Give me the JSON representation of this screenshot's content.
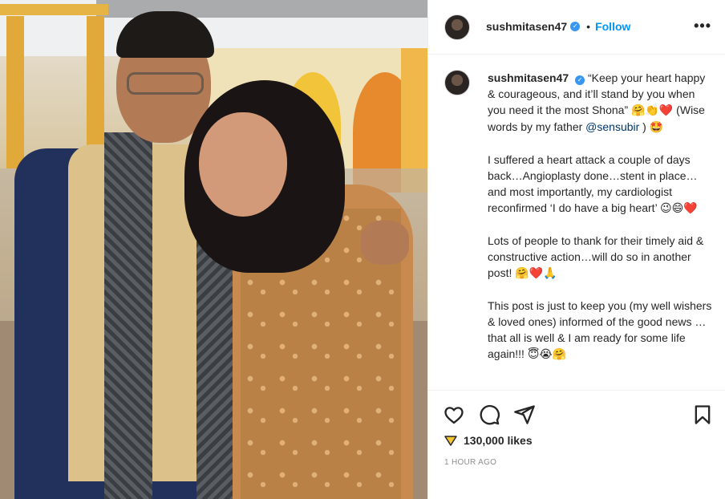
{
  "post": {
    "username": "sushmitasen47",
    "follow_label": "Follow",
    "dot": "•",
    "more": "•••",
    "caption": {
      "p1_line1": "“Keep your heart happy & courageous, and it’ll stand by you when you need it the most Shona”",
      "p1_emoji1": "🤗👏❤️",
      "p1_line2": " (Wise words by my father ",
      "mention": "@sensubir",
      "p1_line3": " ) ",
      "p1_emoji2": "🤩",
      "p2": "I suffered a heart attack a couple of days back…Angioplasty done…stent in place…and most importantly, my cardiologist reconfirmed ‘I do have a big heart’ ",
      "p2_emoji": "😉😄❤️",
      "p3": "Lots of people to thank for their timely aid & constructive action…will do so in another post! ",
      "p3_emoji": "🤗❤️🙏",
      "p4": "This post is just to keep you (my well wishers & loved ones) informed of the good news …that all is well & I am ready for some life again!!! ",
      "p4_emoji": "😇😭🤗"
    },
    "likes": "130,000 likes",
    "time": "1 HOUR AGO"
  },
  "icons": {
    "verified": "verified-badge-icon",
    "like": "heart-icon",
    "comment": "comment-icon",
    "share": "share-icon",
    "save": "bookmark-icon",
    "likes_emoji": "likes-emoji-icon"
  },
  "colors": {
    "link": "#0095f6",
    "mention": "#00376b",
    "verified": "#3897f0",
    "muted": "#8e8e8e"
  }
}
